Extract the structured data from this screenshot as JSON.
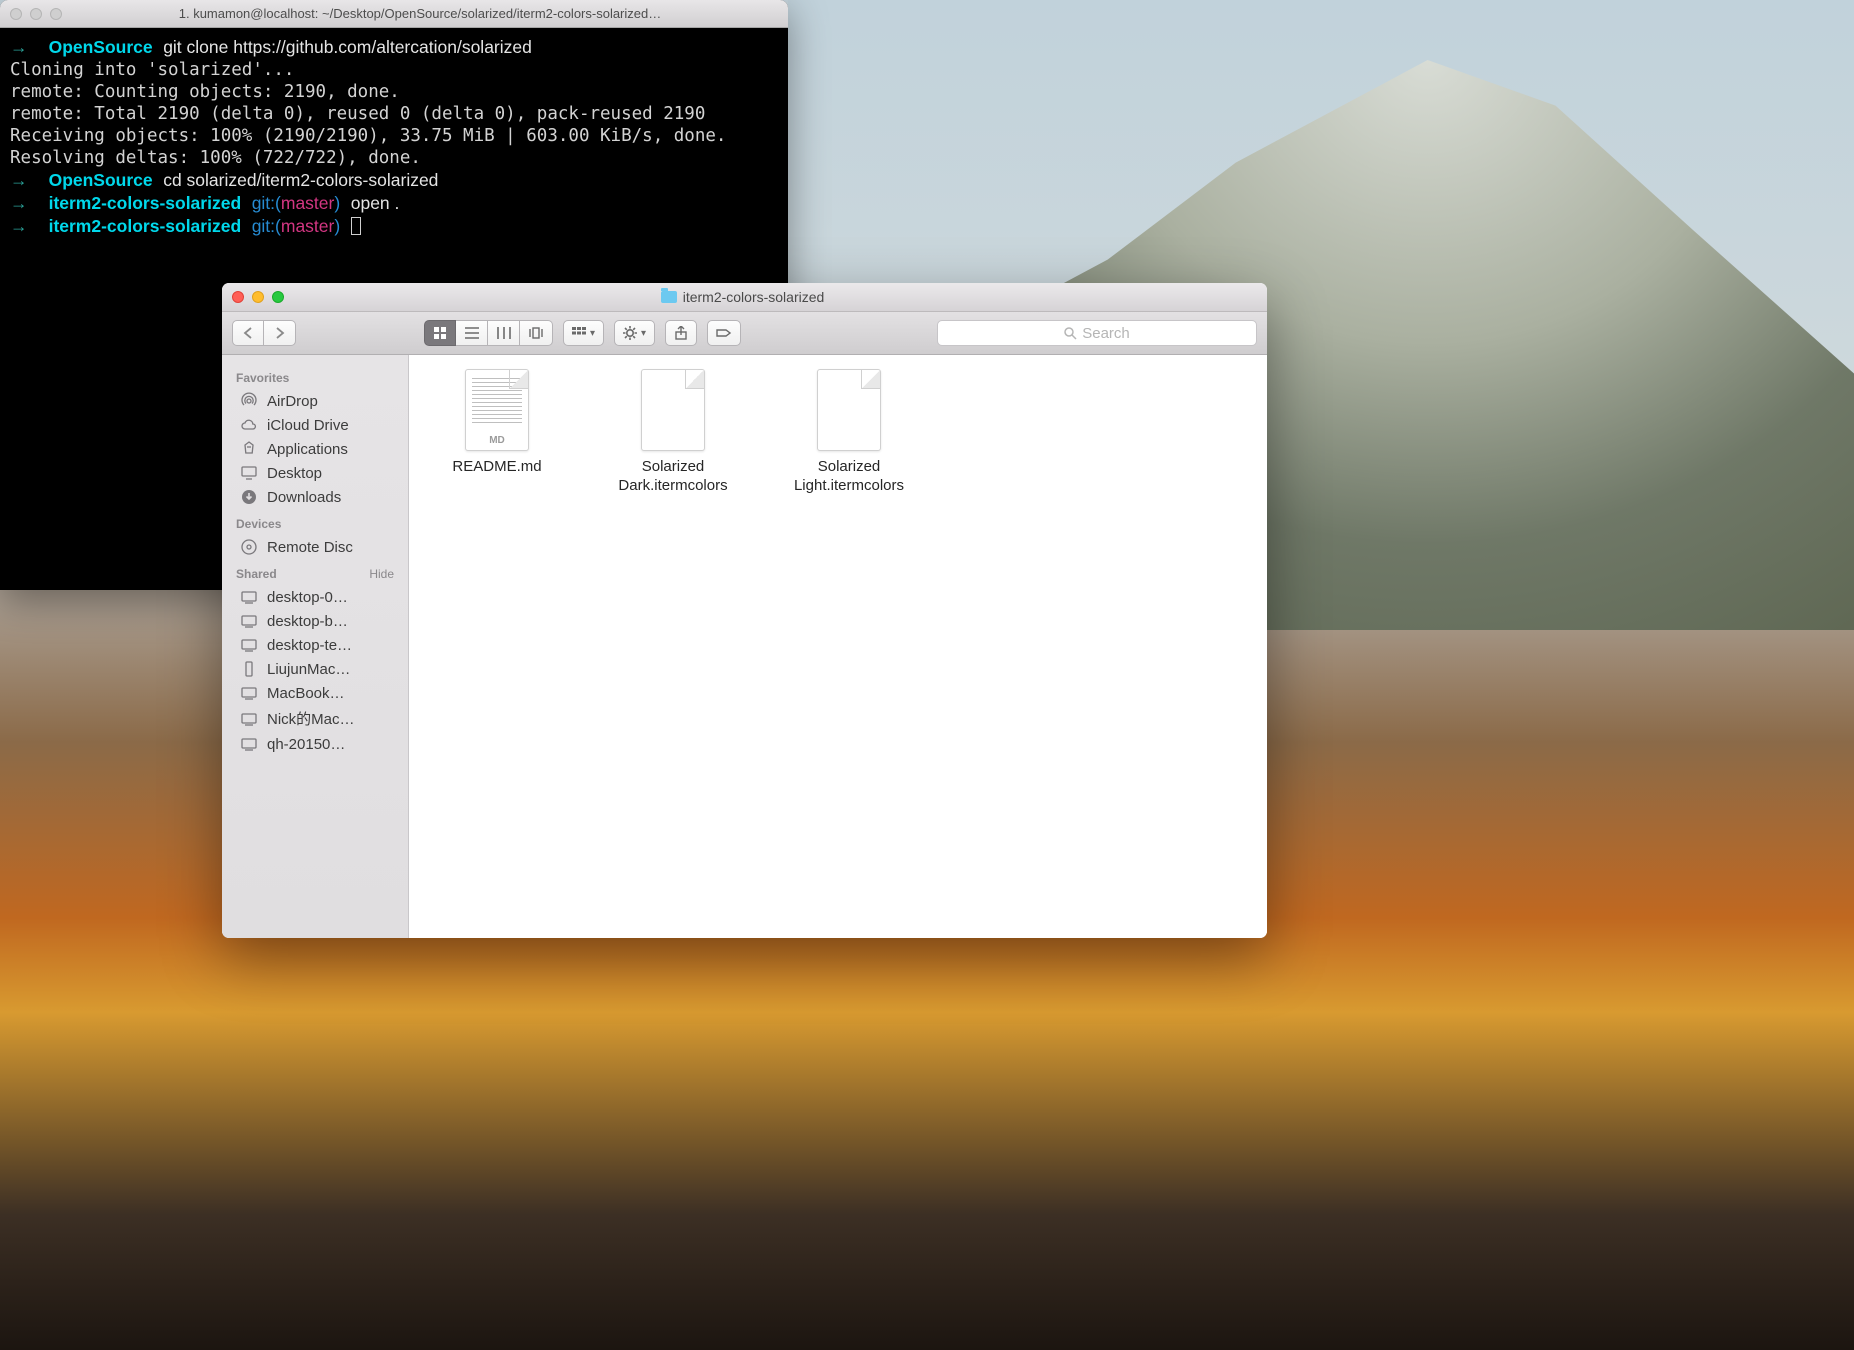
{
  "terminal": {
    "title": "1. kumamon@localhost: ~/Desktop/OpenSource/solarized/iterm2-colors-solarized…",
    "lines": [
      {
        "arrow": "→",
        "ctx": "OpenSource",
        "cmd": "git clone https://github.com/altercation/solarized"
      },
      {
        "out": "Cloning into 'solarized'..."
      },
      {
        "out": "remote: Counting objects: 2190, done."
      },
      {
        "out": "remote: Total 2190 (delta 0), reused 0 (delta 0), pack-reused 2190"
      },
      {
        "out": "Receiving objects: 100% (2190/2190), 33.75 MiB | 603.00 KiB/s, done."
      },
      {
        "out": "Resolving deltas: 100% (722/722), done."
      },
      {
        "arrow": "→",
        "ctx": "OpenSource",
        "cmd": "cd solarized/iterm2-colors-solarized"
      },
      {
        "arrow": "→",
        "ctx": "iterm2-colors-solarized",
        "git": "git:",
        "branch": "master",
        "cmd": "open ."
      },
      {
        "arrow": "→",
        "ctx": "iterm2-colors-solarized",
        "git": "git:",
        "branch": "master",
        "cursor": true
      }
    ]
  },
  "finder": {
    "title": "iterm2-colors-solarized",
    "search_placeholder": "Search",
    "sidebar": {
      "favorites_header": "Favorites",
      "favorites": [
        {
          "icon": "airdrop",
          "label": "AirDrop"
        },
        {
          "icon": "cloud",
          "label": "iCloud Drive"
        },
        {
          "icon": "apps",
          "label": "Applications"
        },
        {
          "icon": "desktop",
          "label": "Desktop"
        },
        {
          "icon": "downloads",
          "label": "Downloads"
        }
      ],
      "devices_header": "Devices",
      "devices": [
        {
          "icon": "disc",
          "label": "Remote Disc"
        }
      ],
      "shared_header": "Shared",
      "hide_label": "Hide",
      "shared": [
        {
          "icon": "pc",
          "label": "desktop-0…"
        },
        {
          "icon": "pc",
          "label": "desktop-b…"
        },
        {
          "icon": "pc",
          "label": "desktop-te…"
        },
        {
          "icon": "tower",
          "label": "LiujunMac…"
        },
        {
          "icon": "pc",
          "label": "MacBook…"
        },
        {
          "icon": "pc",
          "label": "Nick的Mac…"
        },
        {
          "icon": "pc",
          "label": "qh-20150…"
        }
      ]
    },
    "files": [
      {
        "type": "md",
        "name": "README.md"
      },
      {
        "type": "blank",
        "name": "Solarized Dark.itermcolors"
      },
      {
        "type": "blank",
        "name": "Solarized Light.itermcolors"
      }
    ]
  }
}
